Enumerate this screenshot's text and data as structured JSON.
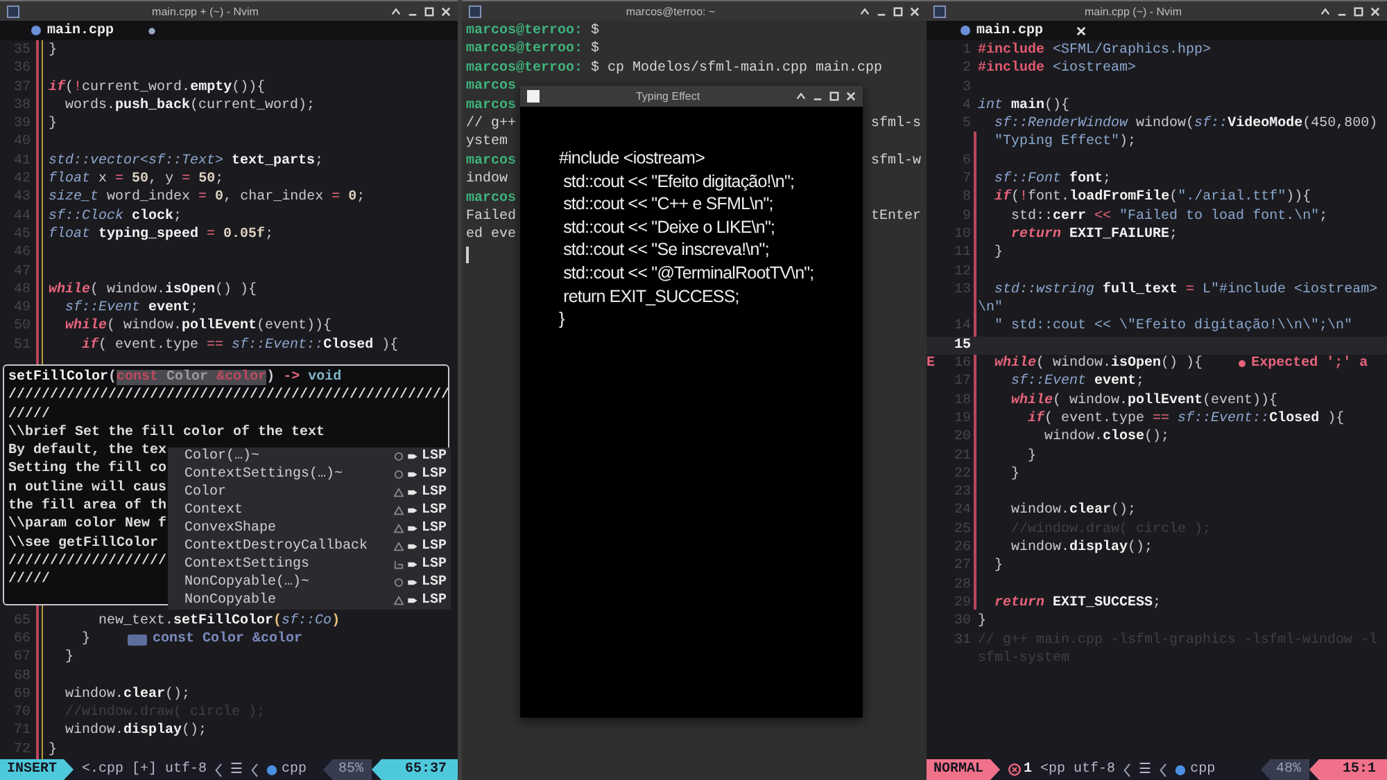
{
  "left_editor": {
    "title": "main.cpp + (~) - Nvim",
    "tab": {
      "name": "main.cpp",
      "modified": true
    },
    "lines_top": [
      {
        "n": "35",
        "code": [
          {
            "kind": "plain",
            "text": "}"
          }
        ]
      },
      {
        "n": "36"
      },
      {
        "n": "37",
        "code": [
          {
            "kind": "kw",
            "text": "if"
          },
          {
            "kind": "plain",
            "text": "("
          },
          {
            "kind": "op",
            "text": "!"
          },
          {
            "kind": "plain",
            "text": "current_word."
          },
          {
            "kind": "fn",
            "text": "empty"
          },
          {
            "kind": "plain",
            "text": "()){"
          }
        ]
      },
      {
        "n": "38",
        "code": [
          {
            "kind": "plain",
            "text": "  words."
          },
          {
            "kind": "fn",
            "text": "push_back"
          },
          {
            "kind": "plain",
            "text": "(current_word);"
          }
        ]
      },
      {
        "n": "39",
        "code": [
          {
            "kind": "plain",
            "text": "}"
          }
        ]
      },
      {
        "n": "40"
      },
      {
        "n": "41",
        "code": [
          {
            "kind": "type",
            "text": "std::vector<sf::Text>"
          },
          {
            "kind": "fn",
            "text": " text_parts"
          },
          {
            "kind": "plain",
            "text": ";"
          }
        ]
      },
      {
        "n": "42",
        "code": [
          {
            "kind": "type",
            "text": "float"
          },
          {
            "kind": "plain",
            "text": " x "
          },
          {
            "kind": "op",
            "text": "="
          },
          {
            "kind": "num",
            "text": " 50"
          },
          {
            "kind": "plain",
            "text": ", y "
          },
          {
            "kind": "op",
            "text": "="
          },
          {
            "kind": "num",
            "text": " 50"
          },
          {
            "kind": "plain",
            "text": ";"
          }
        ]
      },
      {
        "n": "43",
        "code": [
          {
            "kind": "type",
            "text": "size_t"
          },
          {
            "kind": "plain",
            "text": " word_index "
          },
          {
            "kind": "op",
            "text": "="
          },
          {
            "kind": "num",
            "text": " 0"
          },
          {
            "kind": "plain",
            "text": ", char_index "
          },
          {
            "kind": "op",
            "text": "="
          },
          {
            "kind": "num",
            "text": " 0"
          },
          {
            "kind": "plain",
            "text": ";"
          }
        ]
      },
      {
        "n": "44",
        "code": [
          {
            "kind": "type",
            "text": "sf::Clock"
          },
          {
            "kind": "fn",
            "text": " clock"
          },
          {
            "kind": "plain",
            "text": ";"
          }
        ]
      },
      {
        "n": "45",
        "code": [
          {
            "kind": "type",
            "text": "float"
          },
          {
            "kind": "fn",
            "text": " typing_speed "
          },
          {
            "kind": "op",
            "text": "="
          },
          {
            "kind": "num",
            "text": " 0.05f"
          },
          {
            "kind": "plain",
            "text": ";"
          }
        ]
      },
      {
        "n": "46"
      },
      {
        "n": "47"
      },
      {
        "n": "48",
        "code": [
          {
            "kind": "kw",
            "text": "while"
          },
          {
            "kind": "plain",
            "text": "( window."
          },
          {
            "kind": "fn",
            "text": "isOpen"
          },
          {
            "kind": "plain",
            "text": "() ){"
          }
        ]
      },
      {
        "n": "49",
        "code": [
          {
            "kind": "type",
            "text": "  sf::Event"
          },
          {
            "kind": "fn",
            "text": " event"
          },
          {
            "kind": "plain",
            "text": ";"
          }
        ]
      },
      {
        "n": "50",
        "code": [
          {
            "kind": "kw",
            "text": "  while"
          },
          {
            "kind": "plain",
            "text": "( window."
          },
          {
            "kind": "fn",
            "text": "pollEvent"
          },
          {
            "kind": "plain",
            "text": "(event)){"
          }
        ]
      },
      {
        "n": "51",
        "code": [
          {
            "kind": "kw",
            "text": "    if"
          },
          {
            "kind": "plain",
            "text": "( event.type "
          },
          {
            "kind": "op",
            "text": "=="
          },
          {
            "kind": "type",
            "text": " sf::Event::"
          },
          {
            "kind": "fn",
            "text": "Closed"
          },
          {
            "kind": "plain",
            "text": " ){"
          }
        ]
      }
    ],
    "hover": {
      "signature": [
        {
          "kind": "fn",
          "text": "setFillColor"
        },
        {
          "kind": "plain",
          "text": "("
        },
        {
          "kind": "param_kw",
          "text": "const"
        },
        {
          "kind": "param",
          "text": " Color "
        },
        {
          "kind": "param_kw",
          "text": "&color"
        },
        {
          "kind": "plain",
          "text": ")"
        },
        {
          "kind": "op",
          "text": " -> "
        },
        {
          "kind": "ret",
          "text": "void"
        }
      ],
      "lines": [
        "/////////////////////////////////////////////////////",
        "/////",
        "\\\\brief Set the fill color of the text",
        "By default, the tex",
        "Setting the fill co",
        "n outline will caus",
        "the fill area of th",
        "\\\\param color New f",
        "\\\\see getFillColor",
        "///////////////////",
        "/////"
      ]
    },
    "completion": [
      {
        "label": "Color(…)~",
        "kind": "function",
        "source": "LSP"
      },
      {
        "label": "ContextSettings(…)~",
        "kind": "function",
        "source": "LSP"
      },
      {
        "label": "Color",
        "kind": "class",
        "source": "LSP"
      },
      {
        "label": "Context",
        "kind": "class",
        "source": "LSP"
      },
      {
        "label": "ConvexShape",
        "kind": "class",
        "source": "LSP"
      },
      {
        "label": "ContextDestroyCallback",
        "kind": "class",
        "source": "LSP"
      },
      {
        "label": "ContextSettings",
        "kind": "struct",
        "source": "LSP"
      },
      {
        "label": "NonCopyable(…)~",
        "kind": "function",
        "source": "LSP"
      },
      {
        "label": "NonCopyable",
        "kind": "class",
        "source": "LSP"
      }
    ],
    "lines_bottom": [
      {
        "n": "65",
        "code": [
          {
            "kind": "plain",
            "text": "      new_text."
          },
          {
            "kind": "fn",
            "text": "setFillColor"
          },
          {
            "kind": "bracket",
            "text": "("
          },
          {
            "kind": "type",
            "text": "sf::Co"
          },
          {
            "kind": "bracket",
            "text": ")"
          }
        ]
      },
      {
        "n": "66",
        "code": [
          {
            "kind": "plain",
            "text": "    }"
          }
        ],
        "hint": "const Color &color"
      },
      {
        "n": "67",
        "code": [
          {
            "kind": "plain",
            "text": "  }"
          }
        ]
      },
      {
        "n": "68"
      },
      {
        "n": "69",
        "code": [
          {
            "kind": "plain",
            "text": "  window."
          },
          {
            "kind": "fn",
            "text": "clear"
          },
          {
            "kind": "plain",
            "text": "();"
          }
        ]
      },
      {
        "n": "70",
        "code": [
          {
            "kind": "comment",
            "text": "  //window.draw( circle );"
          }
        ]
      },
      {
        "n": "71",
        "code": [
          {
            "kind": "plain",
            "text": "  window."
          },
          {
            "kind": "fn",
            "text": "display"
          },
          {
            "kind": "plain",
            "text": "();"
          }
        ]
      },
      {
        "n": "72",
        "code": [
          {
            "kind": "plain",
            "text": "}"
          }
        ]
      }
    ],
    "status": {
      "mode": {
        "label": "INSERT",
        "kind": "insert"
      },
      "file": "<.cpp [+]",
      "encoding": "utf-8",
      "format": "☰",
      "filetype": "cpp",
      "percent": "85%",
      "position": "65:37"
    }
  },
  "terminal": {
    "title": "marcos@terroo: ~",
    "lines": [
      {
        "kind": "prompt",
        "user": "marcos@terroo:",
        "text": " $"
      },
      {
        "kind": "prompt",
        "user": "marcos@terroo:",
        "text": " $"
      },
      {
        "kind": "prompt",
        "user": "marcos@terroo:",
        "text": " $ cp Modelos/sfml-main.cpp main.cpp"
      },
      {
        "kind": "prompt",
        "user": "marcos"
      },
      {
        "kind": "prompt",
        "user": "marcos"
      },
      {
        "kind": "output",
        "text": "// g++",
        "right": "sfml-s"
      },
      {
        "kind": "output",
        "text": "ystem"
      },
      {
        "kind": "prompt",
        "user": "marcos",
        "right": "sfml-w"
      },
      {
        "kind": "output",
        "text": "indow"
      },
      {
        "kind": "prompt",
        "user": "marcos"
      },
      {
        "kind": "output",
        "text": "Failed",
        "right": "tEnter"
      },
      {
        "kind": "output",
        "text": "ed eve"
      }
    ],
    "app_window": {
      "title": "Typing Effect",
      "lines": [
        "#include <iostream>",
        " std::cout << \"Efeito digitação!\\n\";",
        " std::cout << \"C++ e SFML\\n\";",
        " std::cout << \"Deixe o LIKE\\n\";",
        " std::cout << \"Se inscreva!\\n\";",
        " std::cout << \"@TerminalRootTV\\n\";",
        " return EXIT_SUCCESS;",
        "}"
      ]
    }
  },
  "right_editor": {
    "title": "main.cpp (~) - Nvim",
    "tab": {
      "name": "main.cpp",
      "modified": false
    },
    "lines": [
      {
        "n": "1",
        "code": [
          {
            "kind": "preproc",
            "text": "#include"
          },
          {
            "kind": "str",
            "text": " <SFML/Graphics.hpp>"
          }
        ]
      },
      {
        "n": "2",
        "code": [
          {
            "kind": "preproc",
            "text": "#include"
          },
          {
            "kind": "str",
            "text": " <iostream>"
          }
        ]
      },
      {
        "n": "3"
      },
      {
        "n": "4",
        "code": [
          {
            "kind": "type",
            "text": "int"
          },
          {
            "kind": "fn",
            "text": " main"
          },
          {
            "kind": "plain",
            "text": "(){"
          }
        ]
      },
      {
        "n": "5",
        "code": [
          {
            "kind": "type",
            "text": "  sf::RenderWindow"
          },
          {
            "kind": "plain",
            "text": " window("
          },
          {
            "kind": "type",
            "text": "sf::"
          },
          {
            "kind": "fn",
            "text": "VideoMode"
          },
          {
            "kind": "plain",
            "text": "(450,800)"
          }
        ]
      },
      {
        "code": [
          {
            "kind": "str",
            "text": "  \"Typing Effect\""
          },
          {
            "kind": "plain",
            "text": ");"
          }
        ]
      },
      {
        "n": "6"
      },
      {
        "n": "7",
        "code": [
          {
            "kind": "type",
            "text": "  sf::Font"
          },
          {
            "kind": "fn",
            "text": " font"
          },
          {
            "kind": "plain",
            "text": ";"
          }
        ]
      },
      {
        "n": "8",
        "code": [
          {
            "kind": "kw",
            "text": "  if"
          },
          {
            "kind": "plain",
            "text": "("
          },
          {
            "kind": "op",
            "text": "!"
          },
          {
            "kind": "plain",
            "text": "font."
          },
          {
            "kind": "fn",
            "text": "loadFromFile"
          },
          {
            "kind": "plain",
            "text": "("
          },
          {
            "kind": "str",
            "text": "\"./arial.ttf\""
          },
          {
            "kind": "plain",
            "text": ")){"
          }
        ]
      },
      {
        "n": "9",
        "code": [
          {
            "kind": "plain",
            "text": "    std::"
          },
          {
            "kind": "fn",
            "text": "cerr"
          },
          {
            "kind": "op",
            "text": " << "
          },
          {
            "kind": "str",
            "text": "\"Failed to load font.\\n\""
          },
          {
            "kind": "plain",
            "text": ";"
          }
        ]
      },
      {
        "n": "10",
        "code": [
          {
            "kind": "kw",
            "text": "    return"
          },
          {
            "kind": "fn",
            "text": " EXIT_FAILURE"
          },
          {
            "kind": "plain",
            "text": ";"
          }
        ]
      },
      {
        "n": "11",
        "code": [
          {
            "kind": "plain",
            "text": "  }"
          }
        ]
      },
      {
        "n": "12"
      },
      {
        "n": "13",
        "code": [
          {
            "kind": "type",
            "text": "  std::wstring"
          },
          {
            "kind": "fn",
            "text": " full_text "
          },
          {
            "kind": "op",
            "text": "="
          },
          {
            "kind": "str",
            "text": " L\"#include <iostream>"
          }
        ]
      },
      {
        "code": [
          {
            "kind": "str",
            "text": "\\n\""
          }
        ]
      },
      {
        "n": "14",
        "code": [
          {
            "kind": "str",
            "text": "  \" std::cout << \\\"Efeito digitação!\\\\n\\\";\\n\""
          }
        ]
      },
      {
        "n": "15",
        "current": true
      },
      {
        "n": "16",
        "sign": "E",
        "code": [
          {
            "kind": "kw",
            "text": "  while"
          },
          {
            "kind": "plain",
            "text": "( window."
          },
          {
            "kind": "fn",
            "text": "isOpen"
          },
          {
            "kind": "plain",
            "text": "() ){"
          }
        ],
        "diagnostic": "Expected ';' a"
      },
      {
        "n": "17",
        "code": [
          {
            "kind": "type",
            "text": "    sf::Event"
          },
          {
            "kind": "fn",
            "text": " event"
          },
          {
            "kind": "plain",
            "text": ";"
          }
        ]
      },
      {
        "n": "18",
        "code": [
          {
            "kind": "kw",
            "text": "    while"
          },
          {
            "kind": "plain",
            "text": "( window."
          },
          {
            "kind": "fn",
            "text": "pollEvent"
          },
          {
            "kind": "plain",
            "text": "(event)){"
          }
        ]
      },
      {
        "n": "19",
        "code": [
          {
            "kind": "kw",
            "text": "      if"
          },
          {
            "kind": "plain",
            "text": "( event.type "
          },
          {
            "kind": "op",
            "text": "=="
          },
          {
            "kind": "type",
            "text": " sf::Event::"
          },
          {
            "kind": "fn",
            "text": "Closed"
          },
          {
            "kind": "plain",
            "text": " ){"
          }
        ]
      },
      {
        "n": "20",
        "code": [
          {
            "kind": "plain",
            "text": "        window."
          },
          {
            "kind": "fn",
            "text": "close"
          },
          {
            "kind": "plain",
            "text": "();"
          }
        ]
      },
      {
        "n": "21",
        "code": [
          {
            "kind": "plain",
            "text": "      }"
          }
        ]
      },
      {
        "n": "22",
        "code": [
          {
            "kind": "plain",
            "text": "    }"
          }
        ]
      },
      {
        "n": "23"
      },
      {
        "n": "24",
        "code": [
          {
            "kind": "plain",
            "text": "    window."
          },
          {
            "kind": "fn",
            "text": "clear"
          },
          {
            "kind": "plain",
            "text": "();"
          }
        ]
      },
      {
        "n": "25",
        "code": [
          {
            "kind": "comment",
            "text": "    //window.draw( circle );"
          }
        ]
      },
      {
        "n": "26",
        "code": [
          {
            "kind": "plain",
            "text": "    window."
          },
          {
            "kind": "fn",
            "text": "display"
          },
          {
            "kind": "plain",
            "text": "();"
          }
        ]
      },
      {
        "n": "27",
        "code": [
          {
            "kind": "plain",
            "text": "  }"
          }
        ]
      },
      {
        "n": "28"
      },
      {
        "n": "29",
        "code": [
          {
            "kind": "kw",
            "text": "  return"
          },
          {
            "kind": "fn",
            "text": " EXIT_SUCCESS"
          },
          {
            "kind": "plain",
            "text": ";"
          }
        ]
      },
      {
        "n": "30",
        "code": [
          {
            "kind": "plain",
            "text": "}"
          }
        ]
      },
      {
        "n": "31",
        "code": [
          {
            "kind": "comment",
            "text": "// g++ main.cpp -lsfml-graphics -lsfml-window -l"
          }
        ]
      },
      {
        "code": [
          {
            "kind": "comment",
            "text": "sfml-system"
          }
        ]
      }
    ],
    "status": {
      "mode": {
        "label": "NORMAL",
        "kind": "normal"
      },
      "errors": "1",
      "file": "<pp",
      "encoding": "utf-8",
      "format": "☰",
      "filetype": "cpp",
      "percent": "48%",
      "position": "15:1"
    }
  }
}
